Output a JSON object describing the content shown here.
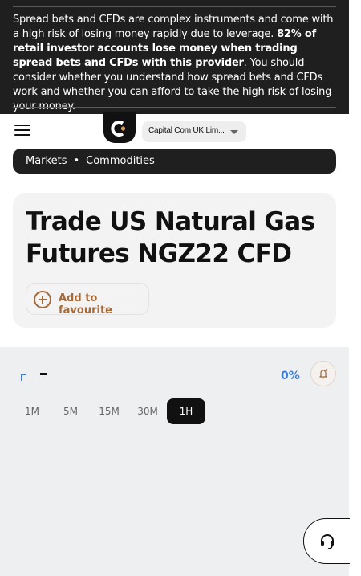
{
  "risk_warning": {
    "part1": "Spread bets and CFDs are complex instruments and come with a high risk of losing money rapidly due to leverage. ",
    "bold": "82% of retail investor accounts lose money when trading spread bets and CFDs with this provider",
    "part2": ". You should consider whether you understand how spread bets and CFDs work and whether you can afford to take the high risk of losing your money."
  },
  "header": {
    "menu_icon": "hamburger-menu-icon",
    "logo_icon": "capital-com-logo-icon",
    "entity_select": "Capital Com UK Lim..."
  },
  "breadcrumb": {
    "items": [
      "Markets",
      "Commodities"
    ],
    "separator": "•"
  },
  "instrument": {
    "title": "Trade US Natural Gas Futures NGZ22 CFD",
    "favourite_label": "Add to favourite"
  },
  "chart_panel": {
    "price": "-",
    "change": "0%",
    "timeframes": [
      "1M",
      "5M",
      "15M",
      "30M",
      "1H"
    ],
    "active_timeframe": "1H",
    "alert_icon": "bell-plus-icon"
  },
  "support": {
    "icon": "headset-icon"
  },
  "colors": {
    "banner_bg": "#1f1f1f",
    "accent_brown": "#a46a3a",
    "change_blue": "#3d7ad6",
    "panel_bg": "#eeeff1"
  }
}
